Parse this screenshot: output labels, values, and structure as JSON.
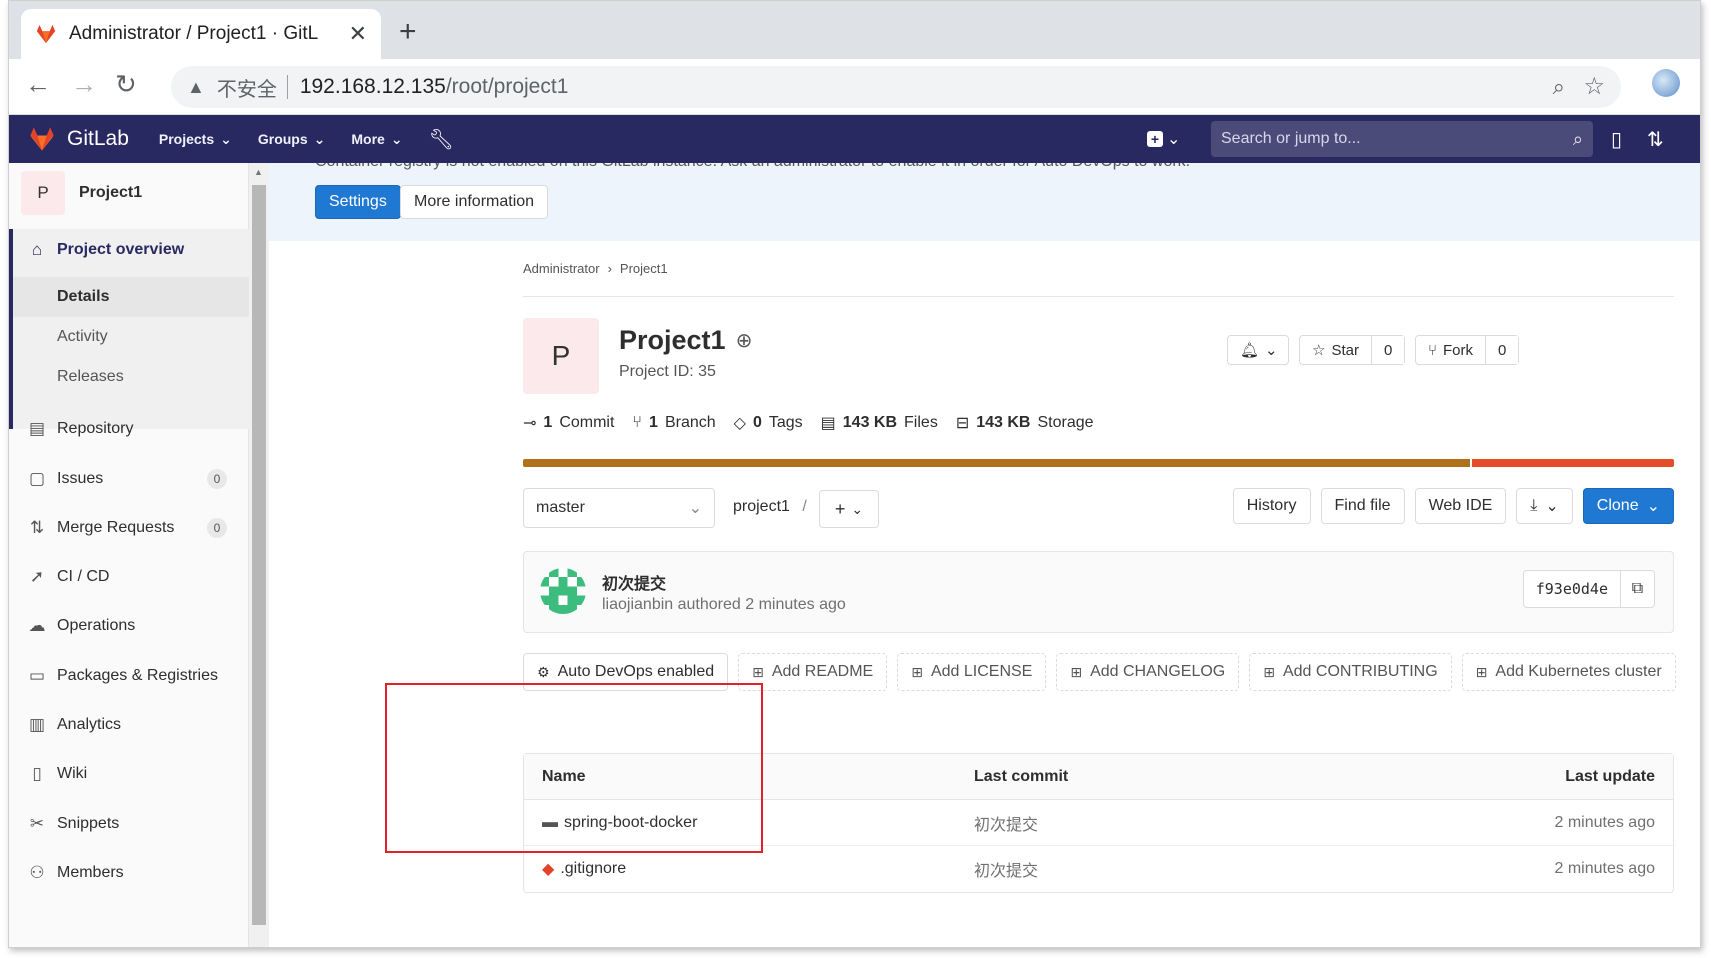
{
  "browser": {
    "tab_title": "Administrator / Project1 · GitL",
    "new_tab": "+",
    "close": "✕",
    "insecure_label": "不安全",
    "url_host": "192.168.12.135",
    "url_path": "/root/project1"
  },
  "gitlab_nav": {
    "brand": "GitLab",
    "menus": [
      "Projects",
      "Groups",
      "More"
    ],
    "search_placeholder": "Search or jump to..."
  },
  "sidebar": {
    "project_initial": "P",
    "project_name": "Project1",
    "overview_label": "Project overview",
    "overview_sub": [
      "Details",
      "Activity",
      "Releases"
    ],
    "items": [
      {
        "label": "Repository",
        "icon": "doc-icon"
      },
      {
        "label": "Issues",
        "icon": "issues-icon",
        "badge": "0"
      },
      {
        "label": "Merge Requests",
        "icon": "merge-icon",
        "badge": "0"
      },
      {
        "label": "CI / CD",
        "icon": "rocket-icon"
      },
      {
        "label": "Operations",
        "icon": "cloud-icon"
      },
      {
        "label": "Packages & Registries",
        "icon": "package-icon"
      },
      {
        "label": "Analytics",
        "icon": "chart-icon"
      },
      {
        "label": "Wiki",
        "icon": "book-icon"
      },
      {
        "label": "Snippets",
        "icon": "scissors-icon"
      },
      {
        "label": "Members",
        "icon": "users-icon"
      }
    ]
  },
  "banner": {
    "cut_text": "Container registry is not enabled on this GitLab instance. Ask an administrator to enable it in order for Auto DevOps to work.",
    "settings_label": "Settings",
    "more_info_label": "More information"
  },
  "breadcrumb": [
    "Administrator",
    "Project1"
  ],
  "project": {
    "initial": "P",
    "title": "Project1",
    "id_label": "Project ID: 35",
    "star_label": "Star",
    "star_count": "0",
    "fork_label": "Fork",
    "fork_count": "0"
  },
  "stats": [
    {
      "num": "1",
      "label": "Commit"
    },
    {
      "num": "1",
      "label": "Branch"
    },
    {
      "num": "0",
      "label": "Tags"
    },
    {
      "num": "143 KB",
      "label": "Files"
    },
    {
      "num": "143 KB",
      "label": "Storage"
    }
  ],
  "languages": [
    {
      "color": "#b07219",
      "share": 0.824
    },
    {
      "color": "#e34c26",
      "share": 0.176
    }
  ],
  "repo_toolbar": {
    "branch": "master",
    "path": "project1",
    "path_sep": "/",
    "history": "History",
    "find_file": "Find file",
    "web_ide": "Web IDE",
    "clone": "Clone"
  },
  "last_commit": {
    "message": "初次提交",
    "author": "liaojianbin",
    "authored": "authored",
    "time": "2 minutes ago",
    "sha": "f93e0d4e"
  },
  "quick_actions": [
    {
      "label": "Auto DevOps enabled",
      "icon": "gear-icon",
      "dashed": false
    },
    {
      "label": "Add README",
      "icon": "plus-square-icon",
      "dashed": true
    },
    {
      "label": "Add LICENSE",
      "icon": "plus-square-icon",
      "dashed": true
    },
    {
      "label": "Add CHANGELOG",
      "icon": "plus-square-icon",
      "dashed": true
    },
    {
      "label": "Add CONTRIBUTING",
      "icon": "plus-square-icon",
      "dashed": true
    },
    {
      "label": "Add Kubernetes cluster",
      "icon": "plus-square-icon",
      "dashed": true
    }
  ],
  "file_table": {
    "headers": {
      "name": "Name",
      "last_commit": "Last commit",
      "last_update": "Last update"
    },
    "rows": [
      {
        "name": "spring-boot-docker",
        "type": "folder",
        "commit": "初次提交",
        "updated": "2 minutes ago"
      },
      {
        "name": ".gitignore",
        "type": "git-file",
        "commit": "初次提交",
        "updated": "2 minutes ago"
      }
    ]
  },
  "colors": {
    "navbar": "#292961",
    "primary": "#1f78d1",
    "annotation": "#e0202a"
  }
}
